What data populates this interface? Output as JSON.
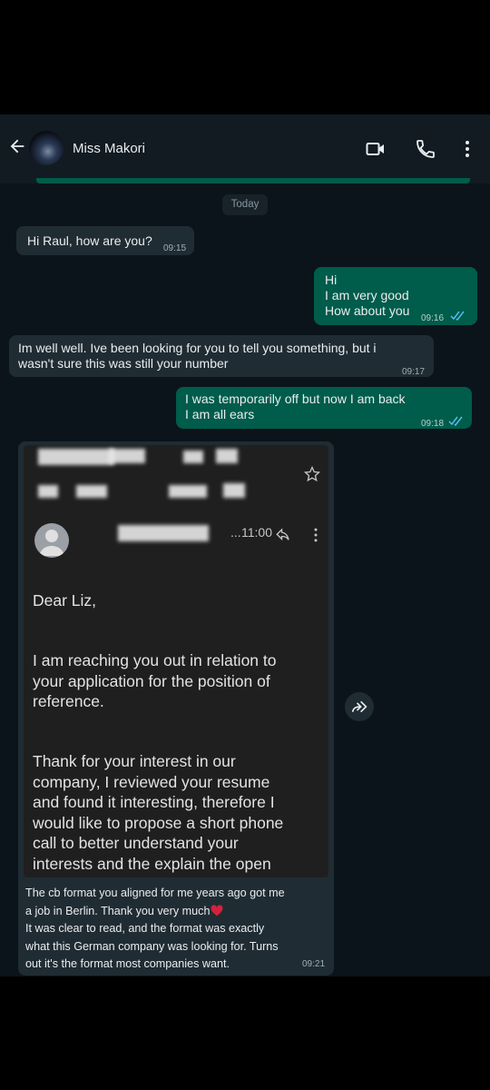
{
  "header": {
    "contact_name": "Miss Makori",
    "icons": [
      "back-arrow-icon",
      "video-call-icon",
      "phone-icon",
      "more-options-icon"
    ]
  },
  "date_separator": "Today",
  "messages": [
    {
      "direction": "incoming",
      "text": "Hi Raul, how are you?",
      "time": "09:15"
    },
    {
      "direction": "outgoing",
      "text": "Hi\nI am very good\nHow about you",
      "time": "09:16",
      "status": "read"
    },
    {
      "direction": "incoming",
      "text": "Im well well. Ive been looking for you to tell you something, but i\nwasn't sure this was still your number",
      "time": "09:17"
    },
    {
      "direction": "outgoing",
      "text": "I was temporarily off but now I am back\nI am all ears",
      "time": "09:18",
      "status": "read"
    }
  ],
  "image_message": {
    "email": {
      "time": "11:00",
      "ellipsis": "...",
      "greeting": "Dear Liz,",
      "paragraph1": "I am reaching you out in relation to\nyour application for the position of\nreference.",
      "paragraph2": "Thank for your interest in our\ncompany, I reviewed your resume\nand found it interesting, therefore I\nwould like to propose a short phone\ncall to better understand your\ninterests and the explain the open"
    },
    "caption_line1": "The cb format you aligned for me years ago got me\na job in Berlin. Thank you very much",
    "caption_line2": "It was clear to read, and the format was exactly\nwhat this German company was looking for. Turns\nout it's the format most companies want.",
    "time": "09:21"
  },
  "colors": {
    "chat_background": "#0b141a",
    "incoming_bubble": "#202c33",
    "outgoing_bubble": "#005c4b",
    "read_ticks": "#53bdeb",
    "heart": "#d4213d"
  }
}
